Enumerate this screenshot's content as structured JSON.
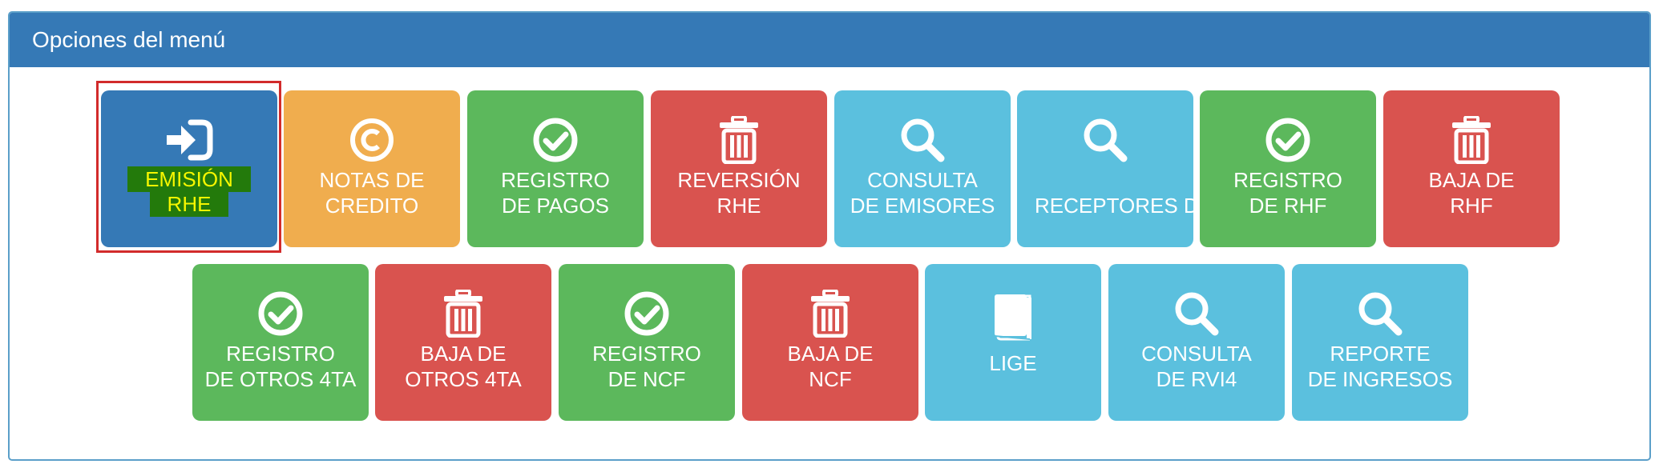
{
  "panel": {
    "title": "Opciones del menú"
  },
  "colors": {
    "header": "#3579b6",
    "blue": "#3579b6",
    "orange": "#f0ad4e",
    "green": "#5cb85c",
    "red": "#d9534f",
    "light_blue": "#5bc0de",
    "highlight_bg": "#237a0b",
    "highlight_text": "#f6f600",
    "selection_border": "#d22b2b"
  },
  "tiles": [
    {
      "id": "emision-rhe",
      "icon": "sign-in-icon",
      "line1": "EMISIÓN",
      "line2": "RHE",
      "color": "blue",
      "selected": true
    },
    {
      "id": "notas-credito",
      "icon": "copyright-icon",
      "line1": "NOTAS DE",
      "line2": "CREDITO",
      "color": "orange"
    },
    {
      "id": "registro-pagos",
      "icon": "check-circle-icon",
      "line1": "REGISTRO",
      "line2": "DE PAGOS",
      "color": "green"
    },
    {
      "id": "reversion-rhe",
      "icon": "trash-icon",
      "line1": "REVERSIÓN",
      "line2": "RHE",
      "color": "red"
    },
    {
      "id": "consulta-emisores",
      "icon": "search-icon",
      "line1": "CONSULTA",
      "line2": "DE EMISORES",
      "color": "light_blue"
    },
    {
      "id": "receptores",
      "icon": "search-icon",
      "line1": "RECEPTORES D",
      "color": "light_blue"
    },
    {
      "id": "registro-rhf",
      "icon": "check-circle-icon",
      "line1": "REGISTRO",
      "line2": "DE RHF",
      "color": "green"
    },
    {
      "id": "baja-rhf",
      "icon": "trash-icon",
      "line1": "BAJA DE",
      "line2": "RHF",
      "color": "red"
    },
    {
      "id": "registro-otros-4ta",
      "icon": "check-circle-icon",
      "line1": "REGISTRO",
      "line2": "DE OTROS 4TA",
      "color": "green"
    },
    {
      "id": "baja-otros-4ta",
      "icon": "trash-icon",
      "line1": "BAJA DE",
      "line2": "OTROS 4TA",
      "color": "red"
    },
    {
      "id": "registro-ncf",
      "icon": "check-circle-icon",
      "line1": "REGISTRO",
      "line2": "DE NCF",
      "color": "green"
    },
    {
      "id": "baja-ncf",
      "icon": "trash-icon",
      "line1": "BAJA DE",
      "line2": "NCF",
      "color": "red"
    },
    {
      "id": "lige",
      "icon": "book-icon",
      "line1": "LIGE",
      "color": "light_blue"
    },
    {
      "id": "consulta-rvi4",
      "icon": "search-icon",
      "line1": "CONSULTA",
      "line2": "DE RVI4",
      "color": "light_blue"
    },
    {
      "id": "reporte-ingresos",
      "icon": "search-icon",
      "line1": "REPORTE",
      "line2": "DE INGRESOS",
      "color": "light_blue"
    }
  ]
}
